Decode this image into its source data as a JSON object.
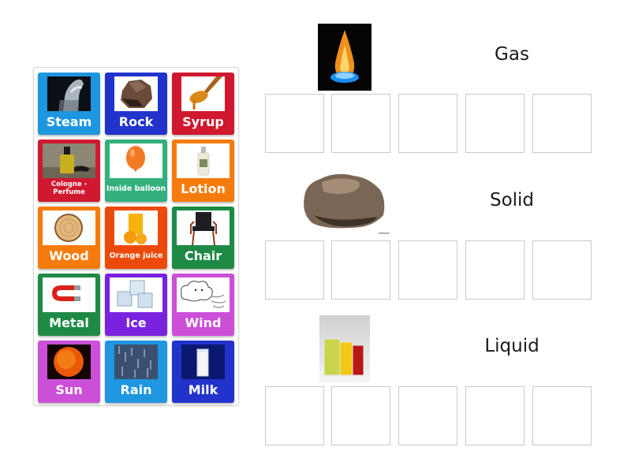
{
  "bank": {
    "tiles": [
      {
        "label": "Steam",
        "color": "#1e96e0",
        "image": "steam-image"
      },
      {
        "label": "Rock",
        "color": "#2233cc",
        "image": "rock-image"
      },
      {
        "label": "Syrup",
        "color": "#d0182e",
        "image": "syrup-image"
      },
      {
        "label": "Cologne - Perfume",
        "line1": "Cologne -",
        "line2": "Perfume",
        "color": "#d0182e",
        "image": "perfume-image"
      },
      {
        "label": "Inside balloon",
        "color": "#33b07d",
        "image": "balloon-image"
      },
      {
        "label": "Lotion",
        "color": "#f57c0c",
        "image": "lotion-image"
      },
      {
        "label": "Wood",
        "color": "#f57c0c",
        "image": "wood-image"
      },
      {
        "label": "Orange juice",
        "color": "#ec4a0a",
        "image": "orange-juice-image"
      },
      {
        "label": "Chair",
        "color": "#1f8a45",
        "image": "chair-image"
      },
      {
        "label": "Metal",
        "color": "#1f8a45",
        "image": "magnet-image"
      },
      {
        "label": "Ice",
        "color": "#7a22e0",
        "image": "ice-image"
      },
      {
        "label": "Wind",
        "color": "#cc4fd8",
        "image": "wind-image"
      },
      {
        "label": "Sun",
        "color": "#cc4fd8",
        "image": "sun-image"
      },
      {
        "label": "Rain",
        "color": "#1e96e0",
        "image": "rain-image"
      },
      {
        "label": "Milk",
        "color": "#2233cc",
        "image": "milk-image"
      }
    ]
  },
  "categories": [
    {
      "title": "Gas",
      "image": "gas-flame-image",
      "slots": 5
    },
    {
      "title": "Solid",
      "image": "rock-image",
      "slots": 5
    },
    {
      "title": "Liquid",
      "image": "colored-drinks-image",
      "slots": 5
    }
  ]
}
